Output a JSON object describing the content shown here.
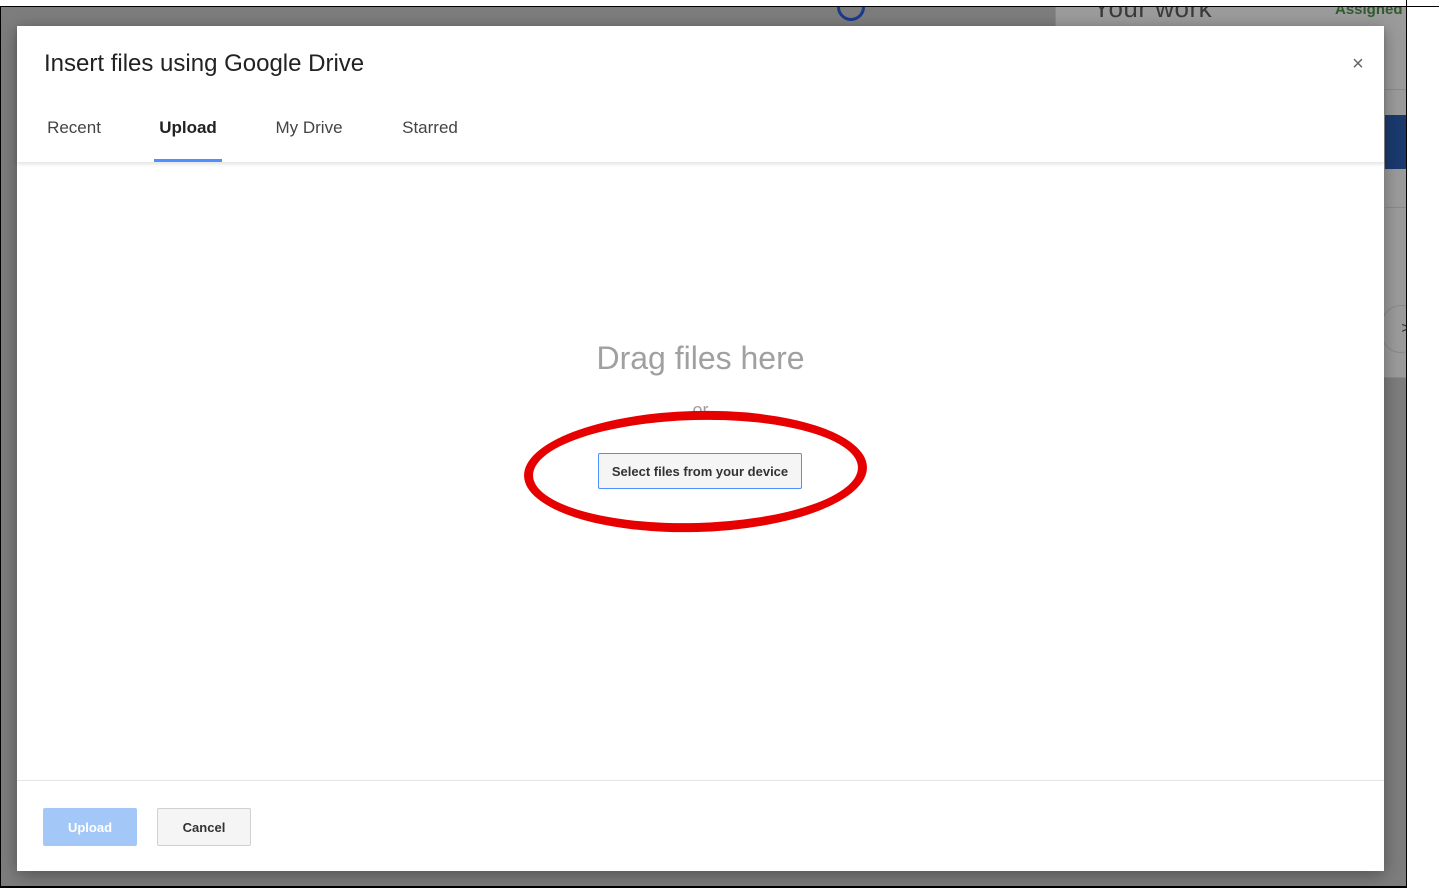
{
  "background": {
    "heading": "Your work",
    "assigned": "Assigned",
    "chevron": ">"
  },
  "dialog": {
    "title": "Insert files using Google Drive",
    "close_label": "×",
    "tabs": [
      {
        "label": "Recent",
        "active": false
      },
      {
        "label": "Upload",
        "active": true
      },
      {
        "label": "My Drive",
        "active": false
      },
      {
        "label": "Starred",
        "active": false
      }
    ],
    "body": {
      "drag_text": "Drag files here",
      "or_text": "or",
      "select_button": "Select files from your device"
    },
    "footer": {
      "upload_label": "Upload",
      "cancel_label": "Cancel"
    }
  },
  "colors": {
    "accent": "#4d90fe",
    "highlight": "#e60000",
    "upload_disabled": "#a3c8f7"
  }
}
